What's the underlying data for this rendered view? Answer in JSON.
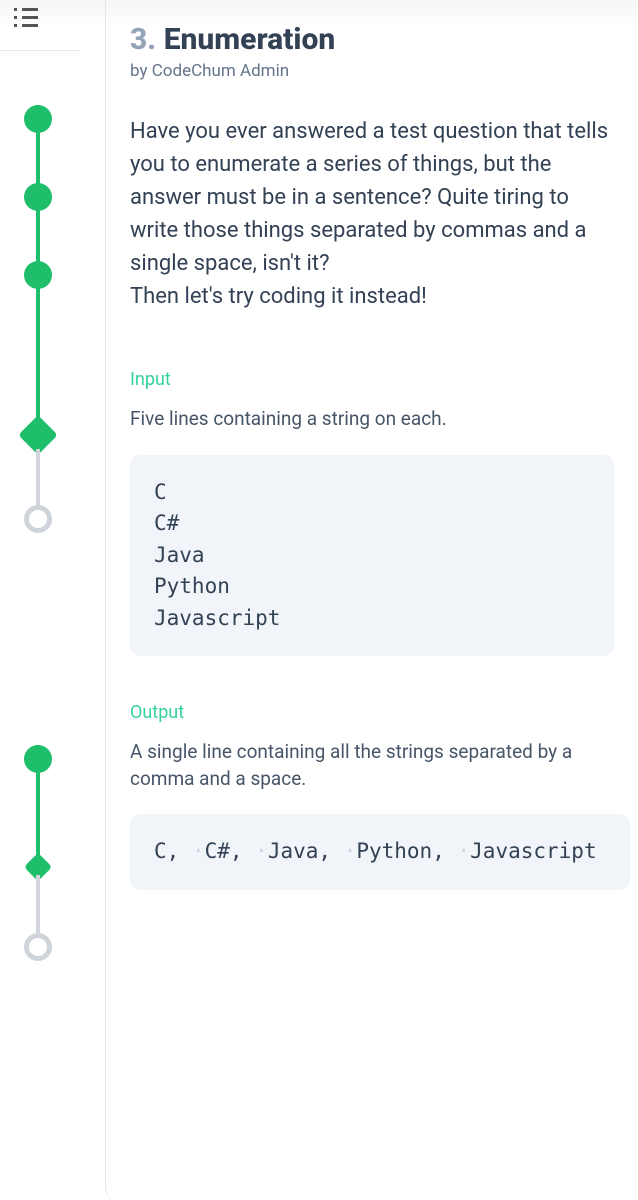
{
  "header": {
    "number": "3.",
    "title": "Enumeration",
    "author": "by CodeChum Admin"
  },
  "description": "Have you ever answered a test question that tells you to enumerate a series of things, but the answer must be in a sentence? Quite tiring to write those things separated by commas and a single space, isn't it?\nThen let's try coding it instead!",
  "input": {
    "label": "Input",
    "text": "Five lines containing a string on each.",
    "code": "C\nC#\nJava\nPython\nJavascript"
  },
  "output": {
    "label": "Output",
    "text": "A single line containing all the strings separated by a comma and a space.",
    "code": "C, ·C#, ·Java, ·Python, ·Javascript"
  }
}
